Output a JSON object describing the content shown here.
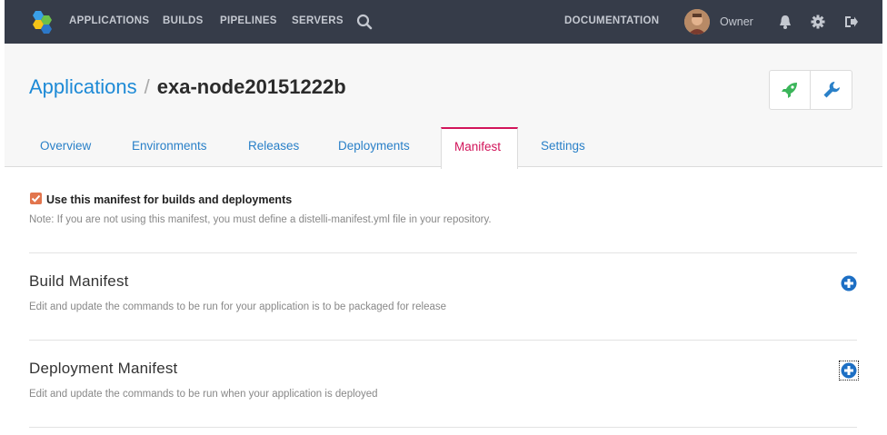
{
  "nav": {
    "links": [
      "APPLICATIONS",
      "BUILDS",
      "PIPELINES",
      "SERVERS"
    ],
    "documentation": "DOCUMENTATION",
    "user": "Owner"
  },
  "breadcrumb": {
    "parent": "Applications",
    "separator": "/",
    "current": "exa-node20151222b"
  },
  "tabs": [
    "Overview",
    "Environments",
    "Releases",
    "Deployments",
    "Manifest",
    "Settings"
  ],
  "active_tab": "Manifest",
  "manifest": {
    "use_checkbox_checked": true,
    "use_label": "Use this manifest for builds and deployments",
    "note": "Note: If you are not using this manifest, you must define a distelli-manifest.yml file in your repository.",
    "sections": [
      {
        "title": "Build Manifest",
        "description": "Edit and update the commands to be run for your application is to be packaged for release"
      },
      {
        "title": "Deployment Manifest",
        "description": "Edit and update the commands to be run when your application is deployed"
      }
    ]
  },
  "colors": {
    "nav_bg": "#363c49",
    "link_blue": "#1d8ad6",
    "active_tab": "#d2145a",
    "checkbox": "#e2754d",
    "deploy_green": "#3bb55a"
  }
}
